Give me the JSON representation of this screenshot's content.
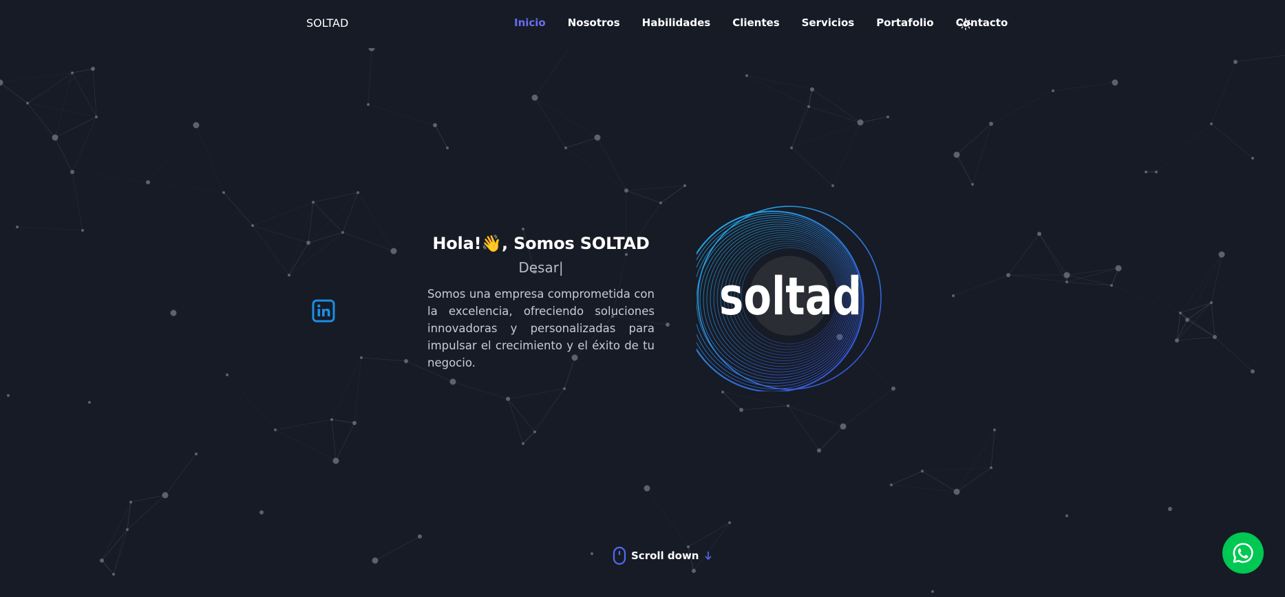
{
  "header": {
    "brand": "SOLTAD",
    "nav": [
      {
        "label": "Inicio",
        "active": true
      },
      {
        "label": "Nosotros",
        "active": false
      },
      {
        "label": "Habilidades",
        "active": false
      },
      {
        "label": "Clientes",
        "active": false
      },
      {
        "label": "Servicios",
        "active": false
      },
      {
        "label": "Portafolio",
        "active": false
      },
      {
        "label": "Contacto",
        "active": false
      }
    ],
    "theme_icon": "sun-icon"
  },
  "hero": {
    "title": "Hola!👋, Somos SOLTAD",
    "subtitle": "Desar|",
    "description": "Somos una empresa comprometida con la excelencia, ofreciendo soluciones innovadoras y personalizadas para impulsar el crecimiento y el éxito de tu negocio.",
    "logo_text": "soltad",
    "social_icon": "linkedin-icon"
  },
  "scroll": {
    "label": "Scroll down",
    "icon": "mouse-icon",
    "arrow_icon": "arrow-down-icon"
  },
  "whatsapp": {
    "icon": "whatsapp-icon"
  },
  "colors": {
    "background": "#171b26",
    "accent": "#6a6ef2",
    "linkedin": "#1a8fe3",
    "whatsapp": "#00c853"
  }
}
